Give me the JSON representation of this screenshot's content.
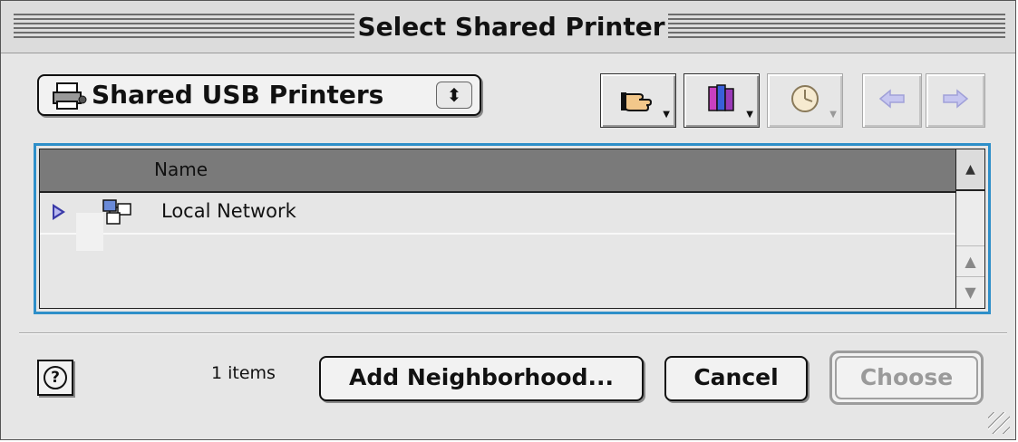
{
  "window": {
    "title": "Select Shared Printer"
  },
  "source_popup": {
    "selected": "Shared USB Printers"
  },
  "toolbar": {
    "shortcuts_icon": "pointing-hand-icon",
    "favorites_icon": "favorites-books-icon",
    "recent_icon": "clock-icon",
    "back_icon": "left-arrow-icon",
    "forward_icon": "right-arrow-icon"
  },
  "list": {
    "column_header": "Name",
    "items": [
      {
        "name": "Local Network",
        "icon": "network-icon"
      }
    ]
  },
  "footer": {
    "help_label": "?",
    "item_count": "1 items",
    "add_label": "Add Neighborhood...",
    "cancel_label": "Cancel",
    "choose_label": "Choose"
  },
  "colors": {
    "focus_ring": "#2e8fc9",
    "disclosure": "#3a3aa8"
  }
}
